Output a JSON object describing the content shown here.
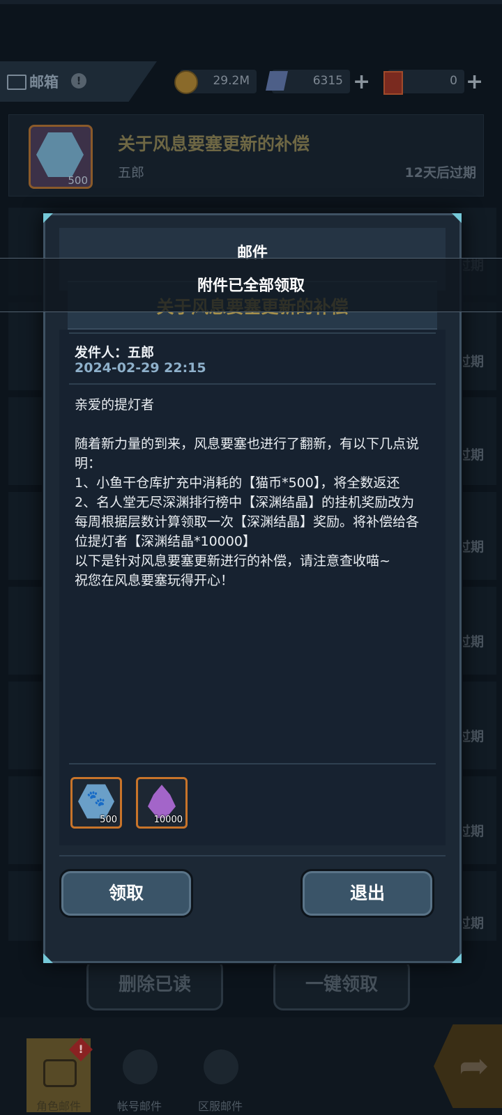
{
  "header": {
    "mailbox_label": "邮箱",
    "warning_glyph": "!",
    "resources": [
      {
        "icon": "coin-icon",
        "value": "29.2M"
      },
      {
        "icon": "crystal-icon",
        "value": "6315"
      },
      {
        "icon": "ticket-icon",
        "value": "0"
      }
    ],
    "plus_glyph": "+"
  },
  "mail_list": {
    "first": {
      "title": "关于风息要塞更新的补偿",
      "sender": "五郎",
      "expires": "12天后过期",
      "qty": "500"
    },
    "other_expires": "过期"
  },
  "modal": {
    "title": "邮件",
    "subject": "关于风息要塞更新的补偿",
    "sender_line": "发件人：五郎",
    "date": "2024-02-29 22:15",
    "body": "亲爱的提灯者\n\n随着新力量的到来，风息要塞也进行了翻新，有以下几点说明：\n1、小鱼干仓库扩充中消耗的【猫币*500】，将全数返还\n2、名人堂无尽深渊排行榜中【深渊结晶】的挂机奖励改为每周根据层数计算领取一次【深渊结晶】奖励。将补偿给各位提灯者【深渊结晶*10000】\n以下是针对风息要塞更新进行的补偿，请注意查收喵~\n祝您在风息要塞玩得开心！",
    "attachments": [
      {
        "icon": "paw-token-icon",
        "qty": "500",
        "glyph": "🐾"
      },
      {
        "icon": "abyss-crystal-icon",
        "qty": "10000"
      }
    ],
    "claim_label": "领取",
    "exit_label": "退出"
  },
  "toast": {
    "text": "附件已全部领取"
  },
  "footer": {
    "delete_read_label": "删除已读",
    "claim_all_label": "一键领取",
    "tabs": [
      {
        "label": "角色邮件"
      },
      {
        "label": "帐号邮件"
      },
      {
        "label": "区服邮件"
      }
    ],
    "badge": "!",
    "arrow_glyph": "➦"
  }
}
